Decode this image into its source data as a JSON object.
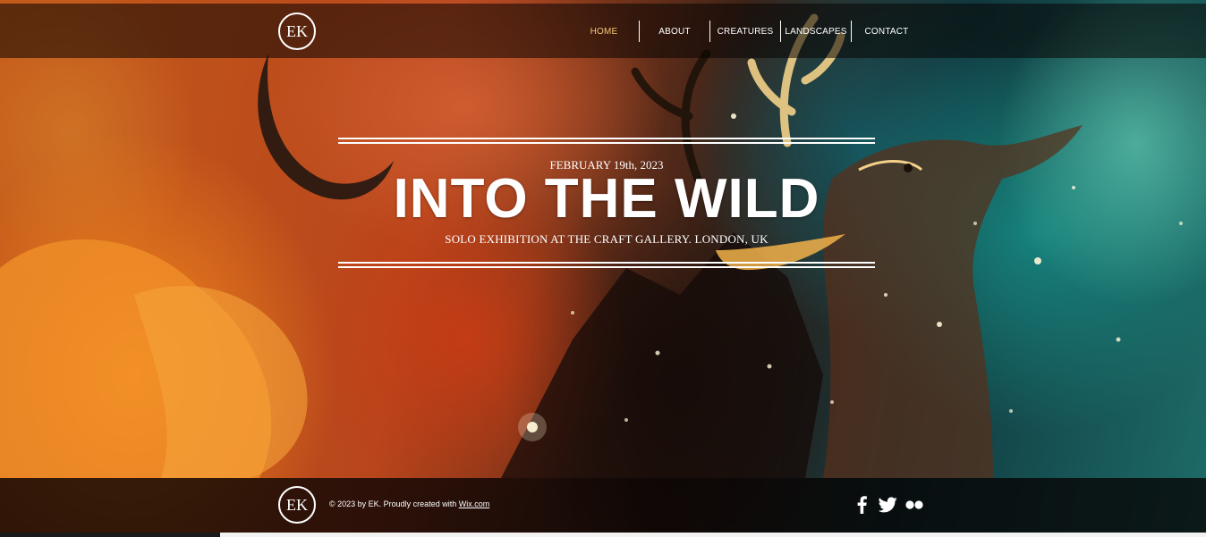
{
  "header": {
    "logo_text": "EK",
    "nav": [
      {
        "label": "HOME",
        "active": true
      },
      {
        "label": "ABOUT",
        "active": false
      },
      {
        "label": "CREATURES",
        "active": false
      },
      {
        "label": "LANDSCAPES",
        "active": false
      },
      {
        "label": "CONTACT",
        "active": false
      }
    ]
  },
  "hero": {
    "date": "FEBRUARY 19th, 2023",
    "title": "INTO THE WILD",
    "subtitle": "SOLO EXHIBITION AT THE CRAFT GALLERY. LONDON, UK"
  },
  "footer": {
    "logo_text": "EK",
    "copyright_prefix": "© 2023 by EK. Proudly created with ",
    "copyright_link": "Wix.com",
    "social": [
      "facebook-icon",
      "twitter-icon",
      "flickr-icon"
    ]
  },
  "colors": {
    "nav_active": "#f3c777",
    "text": "#ffffff",
    "header_bg": "rgba(8,4,2,0.55)",
    "footer_bg": "rgba(6,3,2,0.78)"
  }
}
